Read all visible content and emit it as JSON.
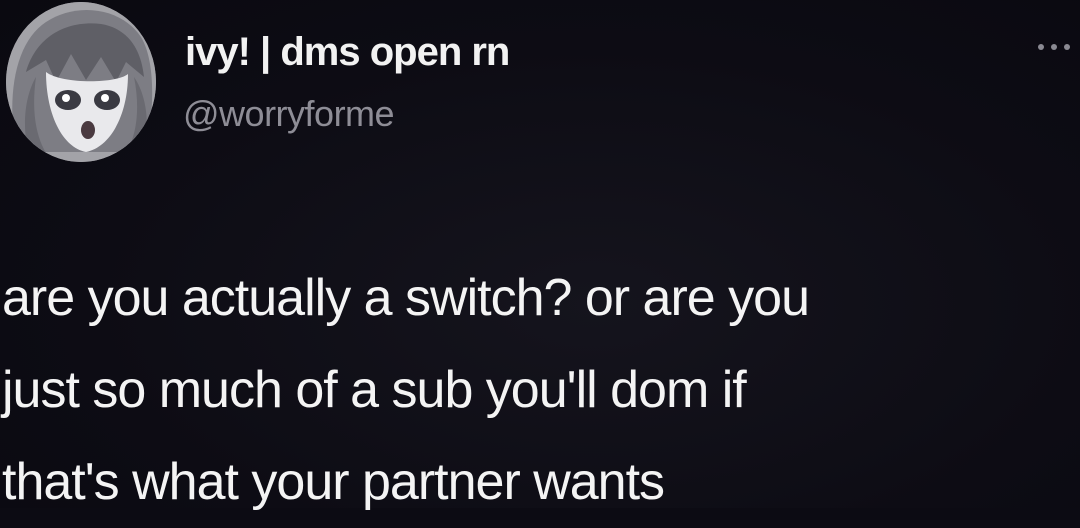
{
  "author": {
    "display_name": "ivy! | dms open rn",
    "handle": "@worryforme",
    "avatar_icon": "anime-avatar-icon"
  },
  "menu": {
    "icon": "more-options-icon"
  },
  "tweet": {
    "lines": [
      "are you actually a switch? or are you",
      "just so much of a sub you'll dom if",
      "that's what your partner wants"
    ]
  },
  "colors": {
    "background": "#0c0b13",
    "text": "#f4f4f4",
    "handle": "#8e8d96"
  }
}
